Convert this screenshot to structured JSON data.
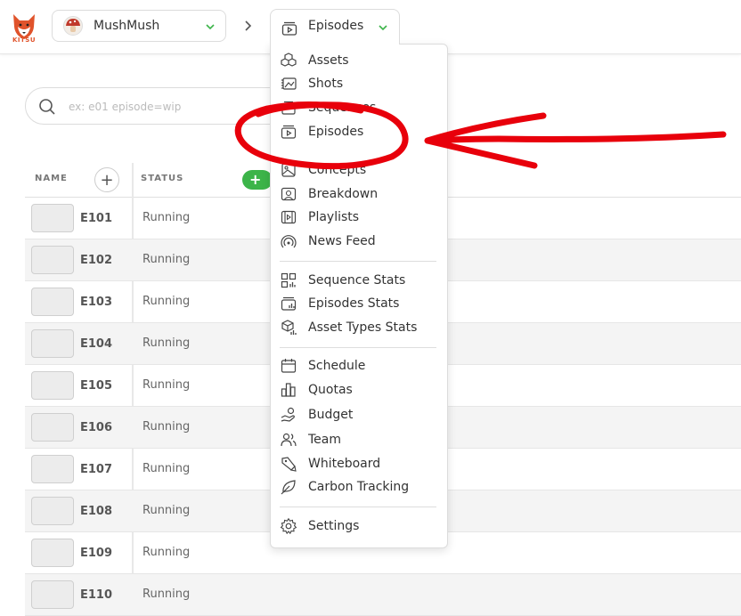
{
  "app": {
    "logo_text": "KITSU",
    "production": "MushMush",
    "current_section": "Episodes"
  },
  "search": {
    "placeholder": "ex: e01 episode=wip"
  },
  "table": {
    "headers": {
      "name": "NAME",
      "status": "STATUS"
    },
    "add_column_label": "+",
    "add_task_label": "+",
    "rows": [
      {
        "name": "E101",
        "status": "Running"
      },
      {
        "name": "E102",
        "status": "Running"
      },
      {
        "name": "E103",
        "status": "Running"
      },
      {
        "name": "E104",
        "status": "Running"
      },
      {
        "name": "E105",
        "status": "Running"
      },
      {
        "name": "E106",
        "status": "Running"
      },
      {
        "name": "E107",
        "status": "Running"
      },
      {
        "name": "E108",
        "status": "Running"
      },
      {
        "name": "E109",
        "status": "Running"
      },
      {
        "name": "E110",
        "status": "Running"
      }
    ]
  },
  "menu": {
    "items": [
      {
        "label": "Assets",
        "icon": "assets-icon"
      },
      {
        "label": "Shots",
        "icon": "shots-icon"
      },
      {
        "label": "Sequences",
        "icon": "sequences-icon"
      },
      {
        "label": "Episodes",
        "icon": "episodes-icon"
      },
      {
        "label": "Concepts",
        "icon": "concepts-icon"
      },
      {
        "label": "Breakdown",
        "icon": "breakdown-icon"
      },
      {
        "label": "Playlists",
        "icon": "playlists-icon"
      },
      {
        "label": "News Feed",
        "icon": "news-feed-icon"
      },
      {
        "label": "Sequence Stats",
        "icon": "sequence-stats-icon"
      },
      {
        "label": "Episodes Stats",
        "icon": "episodes-stats-icon"
      },
      {
        "label": "Asset Types Stats",
        "icon": "asset-types-stats-icon"
      },
      {
        "label": "Schedule",
        "icon": "schedule-icon"
      },
      {
        "label": "Quotas",
        "icon": "quotas-icon"
      },
      {
        "label": "Budget",
        "icon": "budget-icon"
      },
      {
        "label": "Team",
        "icon": "team-icon"
      },
      {
        "label": "Whiteboard",
        "icon": "whiteboard-icon"
      },
      {
        "label": "Carbon Tracking",
        "icon": "carbon-tracking-icon"
      },
      {
        "label": "Settings",
        "icon": "settings-icon"
      }
    ]
  },
  "colors": {
    "accent_green": "#3cb449",
    "annotation_red": "#e8000b",
    "logo_orange": "#e0532b"
  }
}
